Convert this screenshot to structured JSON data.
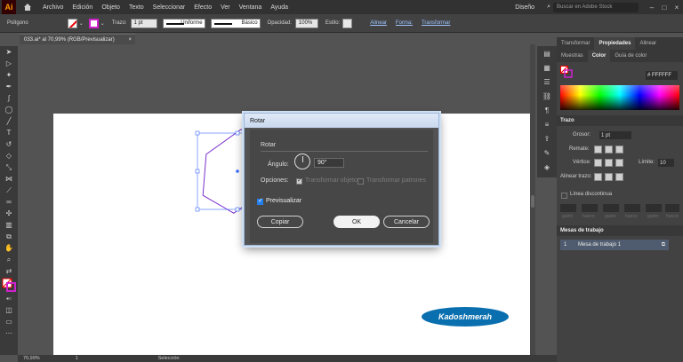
{
  "menubar": {
    "app_logo": "Ai",
    "items": [
      "Archivo",
      "Edición",
      "Objeto",
      "Texto",
      "Seleccionar",
      "Efecto",
      "Ver",
      "Ventana",
      "Ayuda"
    ],
    "workspace": "Diseño",
    "stock_search_placeholder": "Buscar en Adobe Stock"
  },
  "control_bar": {
    "shape_name": "Polígono",
    "stroke_label": "Trazo:",
    "stroke_weight": "1 pt",
    "profile_label": "Uniforme",
    "brush_label": "Básico",
    "opacity_label": "Opacidad:",
    "opacity_value": "100%",
    "style_label": "Estilo:",
    "align_link": "Alinear",
    "shape_link": "Forma:",
    "transform_link": "Transformar"
  },
  "document": {
    "tab_title": "033.ai* al 70,99% (RGB/Previsualizar)",
    "tab_close": "×"
  },
  "dialog": {
    "title": "Rotar",
    "section": "Rotar",
    "angle_label": "Ángulo:",
    "angle_value": "90°",
    "options_label": "Opciones:",
    "transform_objects": "Transformar objetos",
    "transform_patterns": "Transformar patrones",
    "preview_label": "Previsualizar",
    "copy_button": "Copiar",
    "ok_button": "OK",
    "cancel_button": "Cancelar"
  },
  "logo_text": "Kadoshmerah",
  "right_panel": {
    "tabs": [
      "Transformar",
      "Propiedades",
      "Alinear"
    ],
    "color_tabs": [
      "Muestras",
      "Color",
      "Guía de color"
    ],
    "hex_value": "FFFFFF",
    "stroke_panel_title": "Trazo",
    "weight_label": "Grosor:",
    "weight_value": "1 pt",
    "cap_label": "Remate:",
    "corner_label": "Vértice:",
    "limit_label": "Límite:",
    "limit_value": "10",
    "align_stroke_label": "Alinear trazo:",
    "dashed_label": "Línea discontinua",
    "dash_cells": [
      "guión",
      "hueco",
      "guión",
      "hueco",
      "guión",
      "hueco"
    ],
    "artboards_title": "Mesas de trabajo",
    "artboard_index": "1",
    "artboard_name": "Mesa de trabajo 1"
  },
  "statusbar": {
    "zoom": "70,99%",
    "page": "1",
    "mode": "Selección"
  },
  "colors": {
    "accent": "#2680eb",
    "hexagon": "#7b2fd0",
    "selection": "#3d6bff",
    "logo": "#0a6faf"
  }
}
